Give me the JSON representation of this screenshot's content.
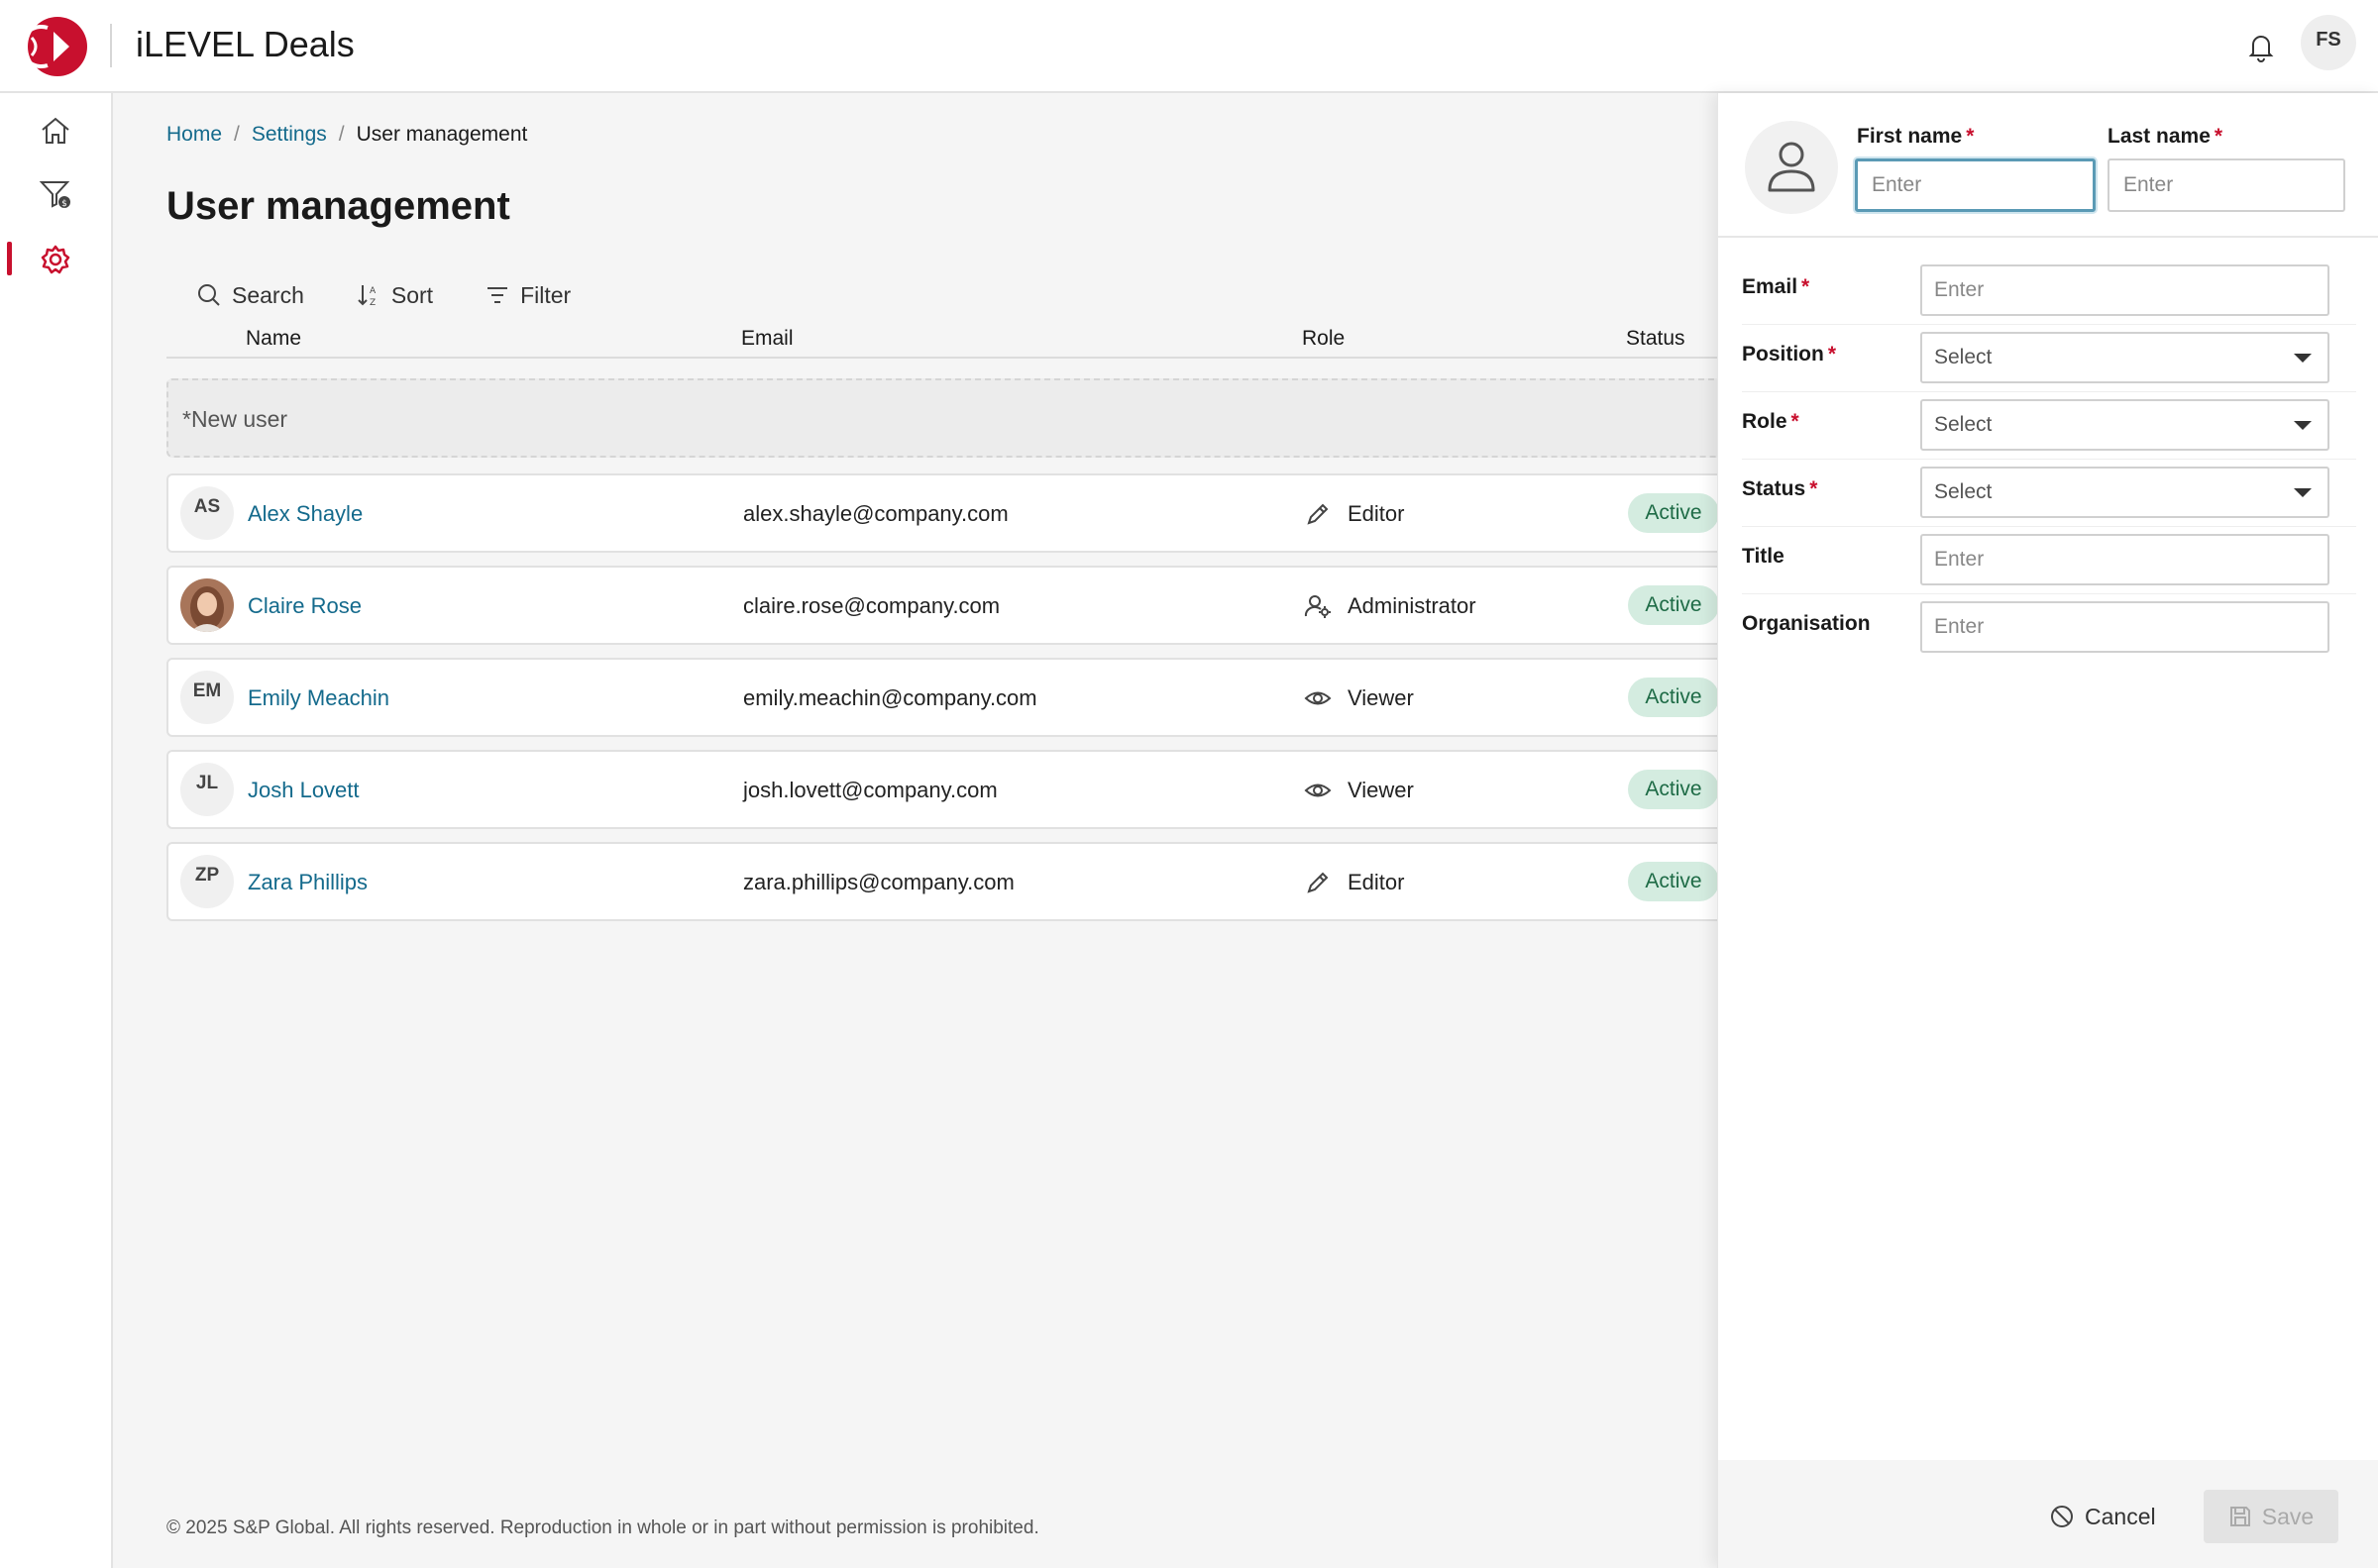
{
  "app": {
    "title": "iLEVEL Deals",
    "user_initials": "FS"
  },
  "nav": {
    "items": [
      "home-icon",
      "filter-dollar-icon",
      "gear-icon"
    ],
    "active": "gear-icon"
  },
  "breadcrumb": {
    "home": "Home",
    "settings": "Settings",
    "current": "User management"
  },
  "page": {
    "title": "User management"
  },
  "toolbar": {
    "search": "Search",
    "sort": "Sort",
    "filter": "Filter"
  },
  "table": {
    "columns": {
      "name": "Name",
      "email": "Email",
      "role": "Role",
      "status": "Status"
    },
    "new_user_label": "*New user",
    "rows": [
      {
        "initials": "AS",
        "name": "Alex Shayle",
        "email": "alex.shayle@company.com",
        "role": "Editor",
        "role_icon": "pencil-icon",
        "status": "Active"
      },
      {
        "initials": "",
        "name": "Claire Rose",
        "email": "claire.rose@company.com",
        "role": "Administrator",
        "role_icon": "user-gear-icon",
        "status": "Active"
      },
      {
        "initials": "EM",
        "name": "Emily Meachin",
        "email": "emily.meachin@company.com",
        "role": "Viewer",
        "role_icon": "eye-icon",
        "status": "Active"
      },
      {
        "initials": "JL",
        "name": "Josh Lovett",
        "email": "josh.lovett@company.com",
        "role": "Viewer",
        "role_icon": "eye-icon",
        "status": "Active"
      },
      {
        "initials": "ZP",
        "name": "Zara Phillips",
        "email": "zara.phillips@company.com",
        "role": "Editor",
        "role_icon": "pencil-icon",
        "status": "Active"
      }
    ]
  },
  "footer": {
    "copyright": "© 2025 S&P Global. All rights reserved. Reproduction in whole or in part without permission is prohibited."
  },
  "panel": {
    "first_name": {
      "label": "First name",
      "placeholder": "Enter",
      "required": "*"
    },
    "last_name": {
      "label": "Last name",
      "placeholder": "Enter",
      "required": "*"
    },
    "fields": [
      {
        "label": "Email",
        "required": "*",
        "type": "input",
        "placeholder": "Enter"
      },
      {
        "label": "Position",
        "required": "*",
        "type": "select",
        "value": "Select"
      },
      {
        "label": "Role",
        "required": "*",
        "type": "select",
        "value": "Select"
      },
      {
        "label": "Status",
        "required": "*",
        "type": "select",
        "value": "Select"
      },
      {
        "label": "Title",
        "required": "",
        "type": "input",
        "placeholder": "Enter"
      },
      {
        "label": "Organisation",
        "required": "",
        "type": "input",
        "placeholder": "Enter"
      }
    ],
    "cancel_label": "Cancel",
    "save_label": "Save"
  },
  "colors": {
    "brand": "#c8102e",
    "link": "#146a8c",
    "active_badge_bg": "#d4ece0",
    "active_badge_text": "#1e6b46"
  }
}
